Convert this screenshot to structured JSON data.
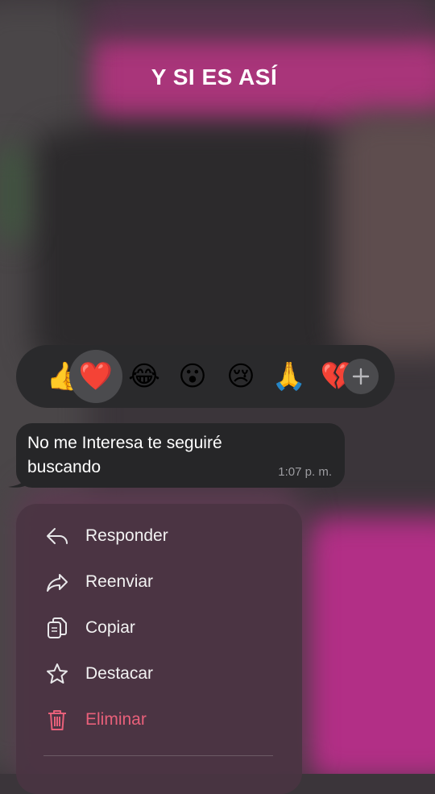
{
  "header": {
    "title": "Y SI ES ASÍ"
  },
  "reactions": {
    "items": [
      {
        "emoji": "👍",
        "name": "thumbs-up"
      },
      {
        "emoji": "❤️",
        "name": "red-heart",
        "selected": true
      },
      {
        "emoji": "😂",
        "name": "tears-of-joy"
      },
      {
        "emoji": "😮",
        "name": "open-mouth"
      },
      {
        "emoji": "😢",
        "name": "crying"
      },
      {
        "emoji": "🙏",
        "name": "folded-hands"
      },
      {
        "emoji": "💔",
        "name": "broken-heart"
      }
    ],
    "more_icon": "plus-icon"
  },
  "message": {
    "text": "No me Interesa te seguiré buscando",
    "time": "1:07 p. m."
  },
  "menu": {
    "items": [
      {
        "label": "Responder",
        "icon": "reply-icon"
      },
      {
        "label": "Reenviar",
        "icon": "forward-icon"
      },
      {
        "label": "Copiar",
        "icon": "copy-icon"
      },
      {
        "label": "Destacar",
        "icon": "star-icon"
      },
      {
        "label": "Eliminar",
        "icon": "trash-icon",
        "danger": true
      }
    ]
  },
  "colors": {
    "danger": "#e8607a",
    "bubble": "#262628",
    "menu_bg": "#4a3442"
  }
}
